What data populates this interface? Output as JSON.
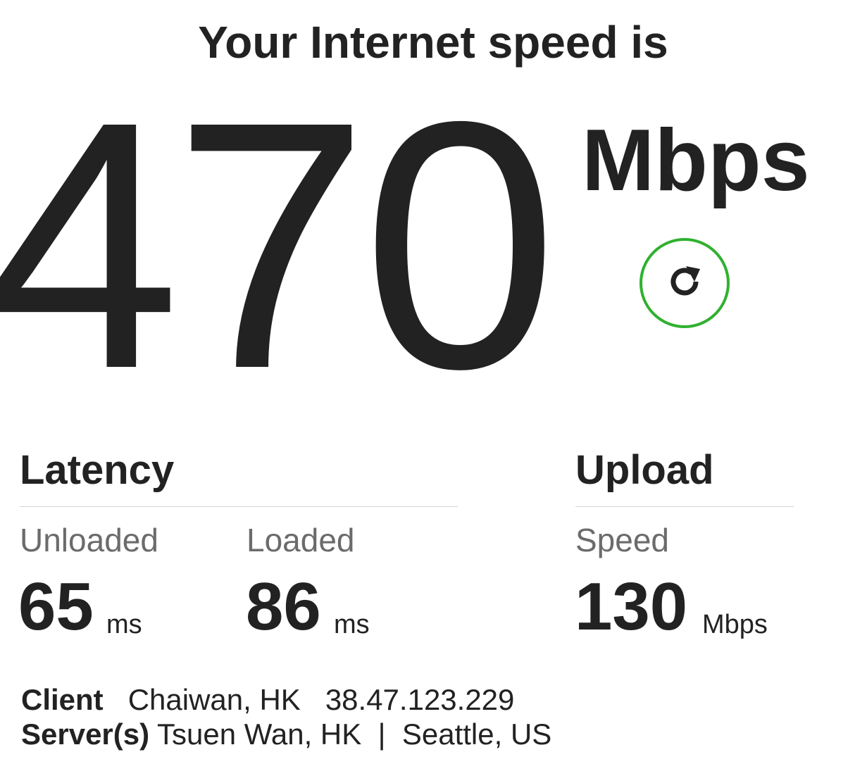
{
  "header": {
    "title": "Your Internet speed is"
  },
  "download": {
    "value": "470",
    "unit": "Mbps"
  },
  "refresh": {
    "icon": "refresh-icon",
    "color": "#2fb12f"
  },
  "latency": {
    "title": "Latency",
    "unloaded": {
      "label": "Unloaded",
      "value": "65",
      "unit": "ms"
    },
    "loaded": {
      "label": "Loaded",
      "value": "86",
      "unit": "ms"
    }
  },
  "upload": {
    "title": "Upload",
    "speed": {
      "label": "Speed",
      "value": "130",
      "unit": "Mbps"
    }
  },
  "client": {
    "label": "Client",
    "location": "Chaiwan, HK",
    "ip": "38.47.123.229"
  },
  "servers": {
    "label": "Server(s)",
    "list": "Tsuen Wan, HK  |  Seattle, US"
  }
}
